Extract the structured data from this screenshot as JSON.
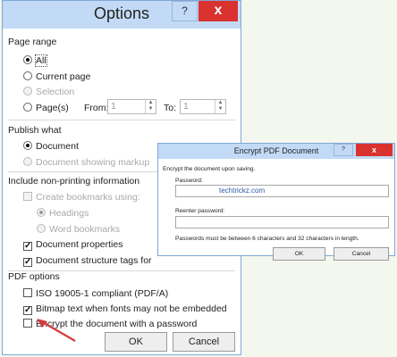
{
  "options": {
    "title": "Options",
    "help": "?",
    "close": "x",
    "page_range": {
      "header": "Page range",
      "all": "All",
      "current_page": "Current page",
      "selection": "Selection",
      "pages": "Page(s)",
      "from_label": "From:",
      "from_value": "1",
      "to_label": "To:",
      "to_value": "1"
    },
    "publish_what": {
      "header": "Publish what",
      "document": "Document",
      "document_markup": "Document showing markup"
    },
    "non_printing": {
      "header": "Include non-printing information",
      "create_bookmarks": "Create bookmarks using:",
      "headings": "Headings",
      "word_bookmarks": "Word bookmarks",
      "doc_properties": "Document properties",
      "doc_structure_tags": "Document structure tags for"
    },
    "pdf_options": {
      "header": "PDF options",
      "iso": "ISO 19005-1 compliant (PDF/A)",
      "bitmap": "Bitmap text when fonts may not be embedded",
      "encrypt": "Encrypt the document with a password"
    },
    "ok": "OK",
    "cancel": "Cancel"
  },
  "encrypt": {
    "title": "Encrypt PDF Document",
    "help": "?",
    "close": "x",
    "intro": "Encrypt the document upon saving.",
    "password_label": "Password:",
    "password_value": "techtrickz.com",
    "reenter_label": "Reenter password:",
    "reenter_value": "",
    "note": "Passwords must be between 6 characters and 32 characters in length.",
    "ok": "OK",
    "cancel": "Cancel"
  },
  "colors": {
    "titlebar": "#c2daf6",
    "close": "#d9322f",
    "link_text": "#2b5aa8",
    "arrow": "#d43a3a"
  }
}
